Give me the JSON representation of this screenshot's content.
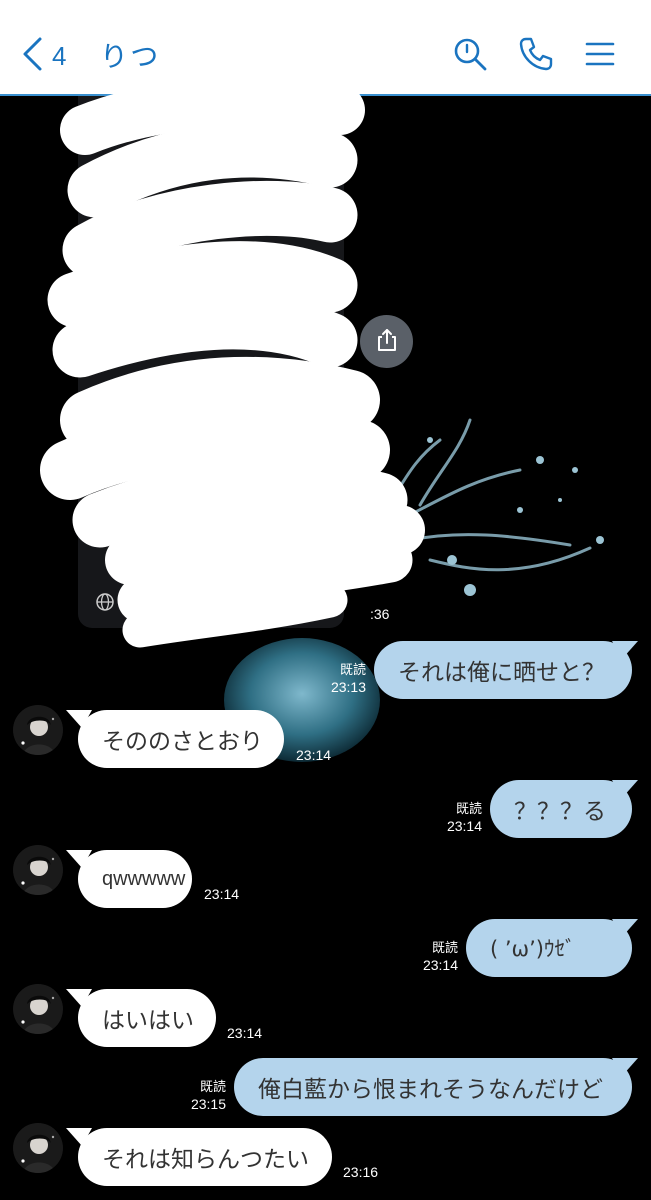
{
  "header": {
    "unread_count": "4",
    "contact_name": "りつ"
  },
  "colors": {
    "accent": "#1a74c0",
    "outgoing_bubble": "#b4d4ec",
    "incoming_bubble": "#ffffff",
    "background": "#000000"
  },
  "icons": {
    "back": "chevron-left-icon",
    "search": "search-icon",
    "call": "phone-icon",
    "menu": "menu-icon",
    "share": "share-icon",
    "globe": "globe-icon"
  },
  "shared_image": {
    "time_partial": ":36"
  },
  "messages": [
    {
      "dir": "out",
      "text": "それは俺に晒せと？",
      "read": "既読",
      "time": "23:13"
    },
    {
      "dir": "in",
      "text": "そののさとおり",
      "time": "23:14"
    },
    {
      "dir": "out",
      "text": "？？？る",
      "read": "既読",
      "time": "23:14"
    },
    {
      "dir": "in",
      "text": "qwwwww",
      "time": "23:14"
    },
    {
      "dir": "out",
      "text": "( ’ω’)ｳｾﾞ",
      "read": "既読",
      "time": "23:14"
    },
    {
      "dir": "in",
      "text": "はいはい",
      "time": "23:14"
    },
    {
      "dir": "out",
      "text": "俺白藍から恨まれそうなんだけど",
      "read": "既読",
      "time": "23:15"
    },
    {
      "dir": "in",
      "text": "それは知らんつたい",
      "time": "23:16"
    }
  ]
}
